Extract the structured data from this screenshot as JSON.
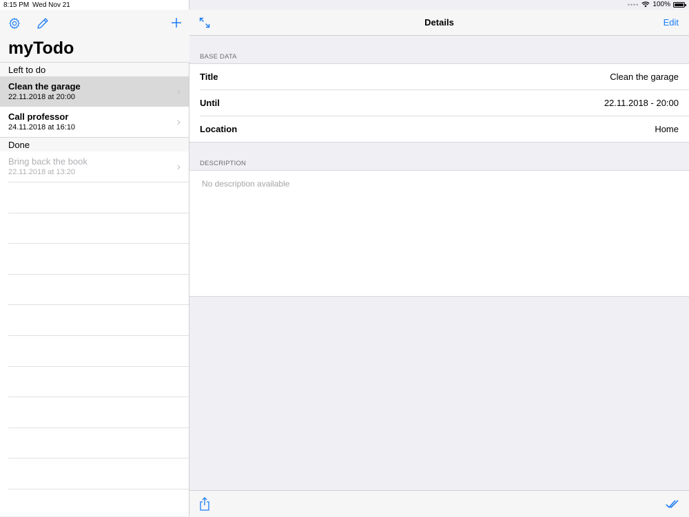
{
  "status_bar": {
    "time": "8:15 PM",
    "date": "Wed Nov 21",
    "battery": "100%"
  },
  "master": {
    "app_title": "myTodo",
    "sections": {
      "todo": "Left to do",
      "done": "Done"
    },
    "todo_items": [
      {
        "title": "Clean the garage",
        "date": "22.11.2018 at 20:00"
      },
      {
        "title": "Call professor",
        "date": "24.11.2018 at 16:10"
      }
    ],
    "done_items": [
      {
        "title": "Bring back the book",
        "date": "22.11.2018 at 13:20"
      }
    ]
  },
  "detail": {
    "title": "Details",
    "edit_label": "Edit",
    "base_data_header": "BASE DATA",
    "fields": [
      {
        "label": "Title",
        "value": "Clean the garage"
      },
      {
        "label": "Until",
        "value": "22.11.2018 - 20:00"
      },
      {
        "label": "Location",
        "value": "Home"
      }
    ],
    "description_header": "DESCRIPTION",
    "description_placeholder": "No description available"
  },
  "colors": {
    "accent": "#1a7cf5"
  }
}
